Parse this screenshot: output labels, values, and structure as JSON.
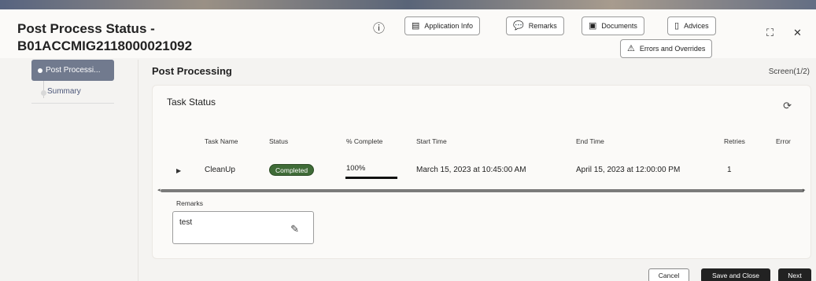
{
  "header": {
    "title_line1": "Post Process Status -",
    "title_line2": "B01ACCMIG2118000021092",
    "buttons": {
      "application_info": "Application Info",
      "remarks": "Remarks",
      "documents": "Documents",
      "advices": "Advices",
      "errors_overrides": "Errors and Overrides"
    },
    "icons": {
      "info": "ⓘ",
      "collapse": "⛶",
      "close": "✕"
    }
  },
  "sidebar": {
    "items": [
      {
        "label": "Post Processi...",
        "active": true
      },
      {
        "label": "Summary",
        "active": false
      }
    ]
  },
  "main": {
    "section_title": "Post Processing",
    "screen_indicator": "Screen(1/2)",
    "panel_title": "Task Status",
    "table": {
      "columns": [
        "Task Name",
        "Status",
        "% Complete",
        "Start Time",
        "End Time",
        "Retries",
        "Error"
      ],
      "rows": [
        {
          "task_name": "CleanUp",
          "status": "Completed",
          "percent": "100%",
          "percent_value": 100,
          "start_time": "March 15, 2023 at 10:45:00 AM",
          "end_time": "April 15, 2023 at 12:00:00 PM",
          "retries": "1",
          "error": ""
        }
      ]
    },
    "remarks_label": "Remarks",
    "remarks_value": "test"
  },
  "footer": {
    "cancel": "Cancel",
    "save_close": "Save and Close",
    "next": "Next"
  },
  "colors": {
    "status_completed": "#3f6b37",
    "sidebar_active": "#717a8e"
  }
}
